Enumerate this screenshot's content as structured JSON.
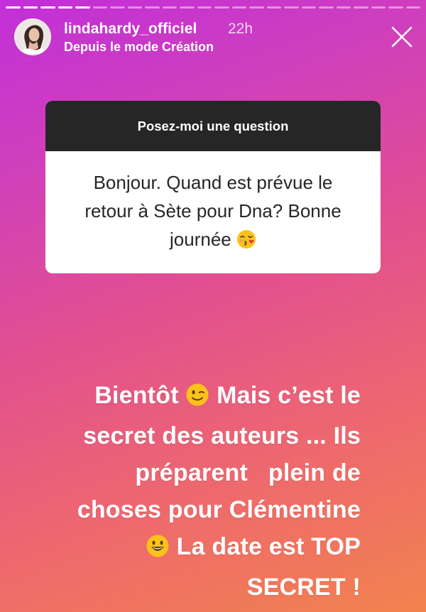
{
  "progress": {
    "segments": [
      1,
      1,
      1,
      1,
      1,
      0,
      0,
      0,
      0,
      0,
      0,
      0,
      0,
      0,
      0,
      0,
      0,
      0,
      0,
      0,
      0,
      0,
      0,
      0
    ]
  },
  "header": {
    "username": "lindahardy_officiel",
    "time": "22h",
    "subline": "Depuis le mode Création",
    "avatar_icon": "profile-photo",
    "close_icon": "close-x"
  },
  "question_sticker": {
    "title": "Posez-moi une question",
    "lines": [
      "Bonjour. Quand est prévue le",
      "retour à Sète pour Dna? Bonne",
      "journée"
    ],
    "emoji": "face-blowing-kiss"
  },
  "answer": {
    "line1_a": "Bientôt",
    "line1_emoji": "winking-face",
    "line1_b": "Mais c’est le",
    "line2": "secret des auteurs ... Ils",
    "line3": "préparent   plein de",
    "line4": "choses pour Clémentine",
    "line5_emoji": "grinning-face",
    "line5": "La date est TOP",
    "line6": "SECRET !"
  },
  "colors": {
    "gradient_top": "#c12fd9",
    "gradient_bottom": "#f2824e",
    "sticker_header": "#262626",
    "sticker_body": "#ffffff",
    "emoji_yellow": "#fcc21b"
  }
}
